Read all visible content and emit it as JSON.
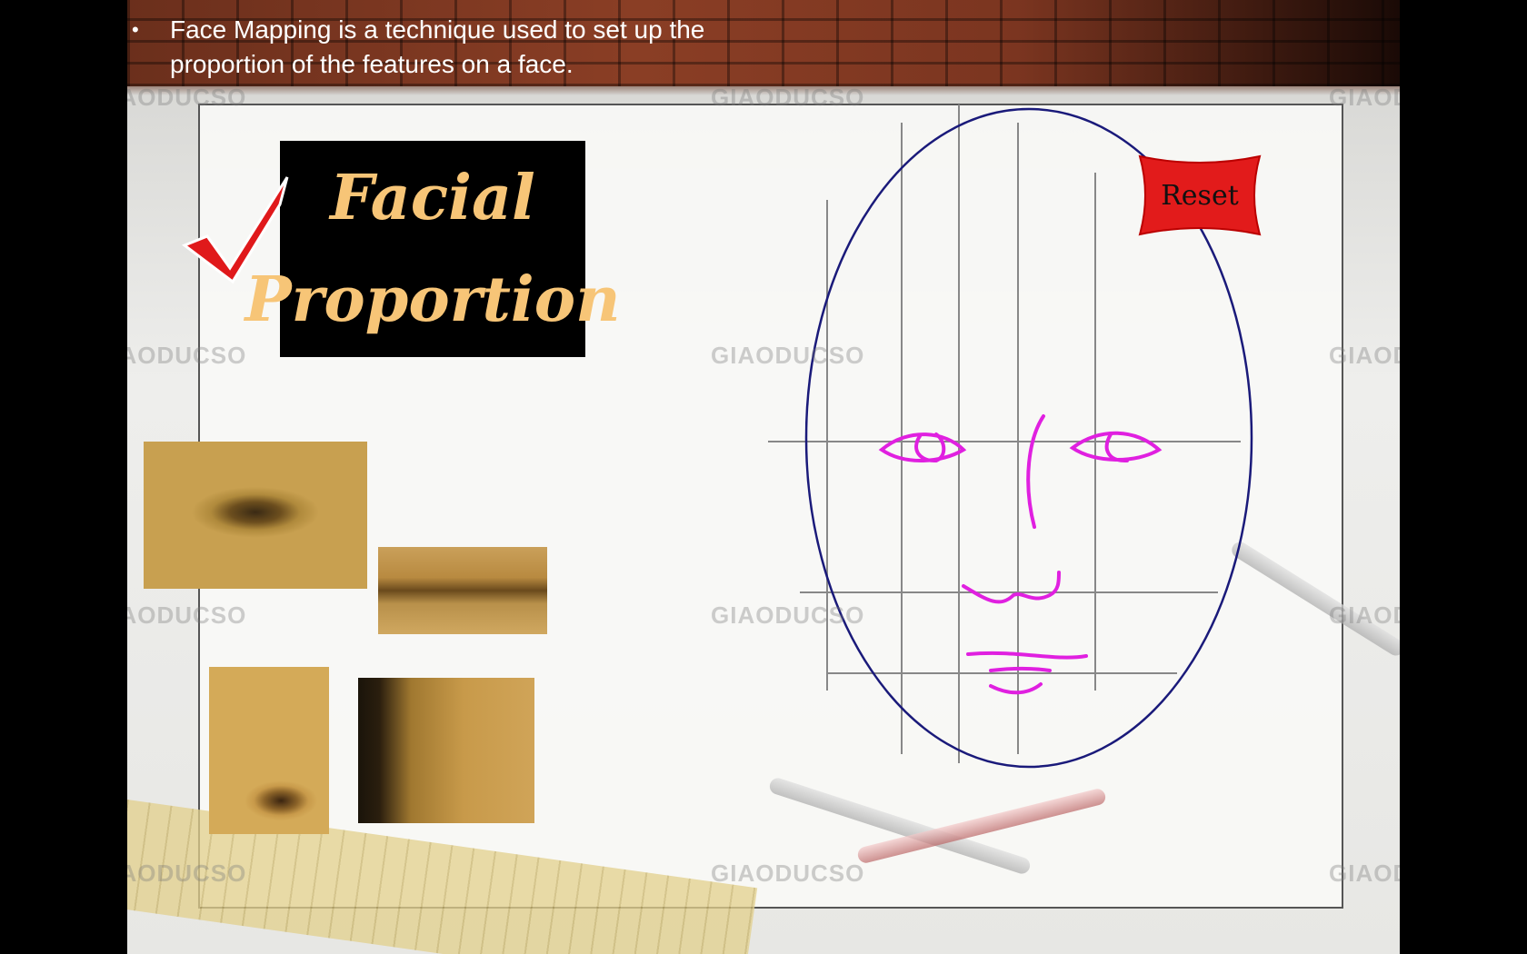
{
  "bullet": {
    "marker": "•",
    "text": "Face Mapping is a technique used to set up the proportion of the features on a face."
  },
  "title": {
    "line1": "Facial",
    "line2": "Proportion"
  },
  "reset_button": {
    "label": "Reset"
  },
  "watermark": {
    "text": "GIAODUCSO"
  },
  "colors": {
    "title_text": "#f7c577",
    "face_outline": "#1a1a7a",
    "face_features": "#e020e0",
    "reset_red": "#e21b1b"
  },
  "icons": {
    "checkmark": "checkmark-icon",
    "reset": "reset-icon",
    "figure": "person-icon"
  }
}
